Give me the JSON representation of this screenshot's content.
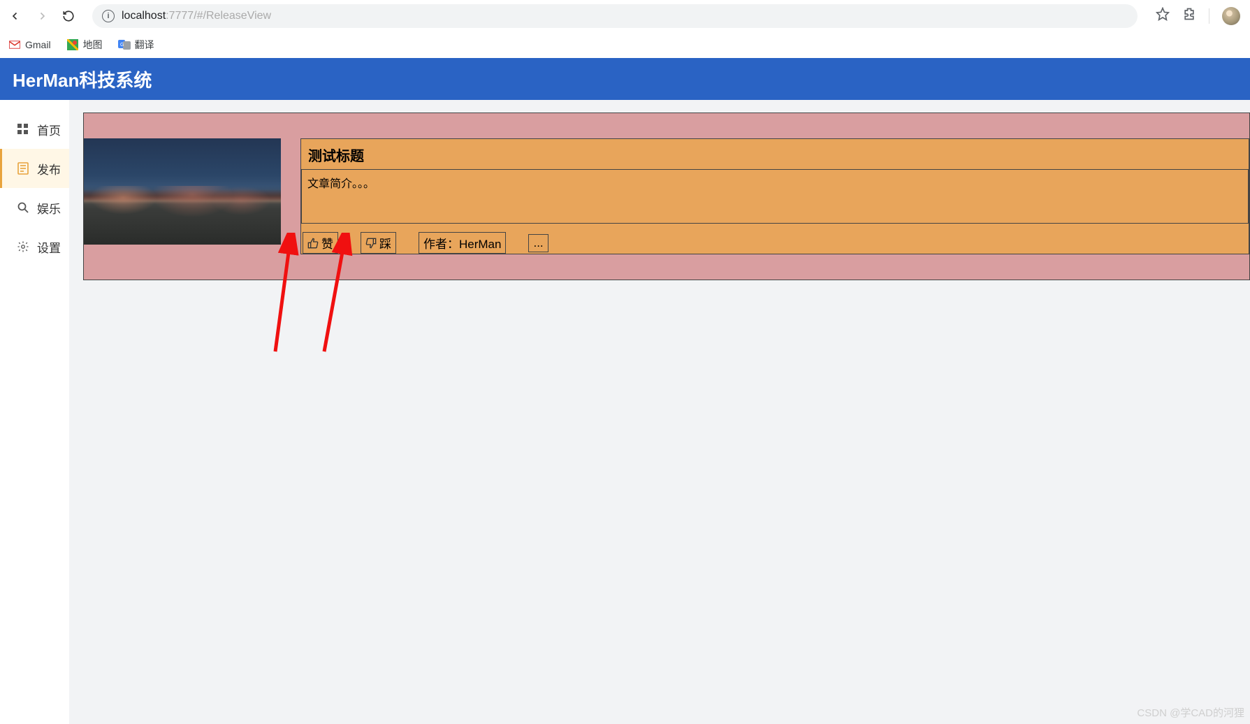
{
  "browser": {
    "url_prefix": "localhost",
    "url_suffix": ":7777/#/ReleaseView"
  },
  "bookmarks": {
    "gmail": "Gmail",
    "maps": "地图",
    "translate": "翻译"
  },
  "header": {
    "title": "HerMan科技系统"
  },
  "sidebar": {
    "items": [
      {
        "label": "首页"
      },
      {
        "label": "发布"
      },
      {
        "label": "娱乐"
      },
      {
        "label": "设置"
      }
    ],
    "active_index": 1
  },
  "article": {
    "title": "测试标题",
    "summary": "文章简介。。。",
    "like_label": "赞",
    "dislike_label": "踩",
    "author_label": "作者：HerMan",
    "more_label": "..."
  },
  "watermark": "CSDN @学CAD的河狸"
}
